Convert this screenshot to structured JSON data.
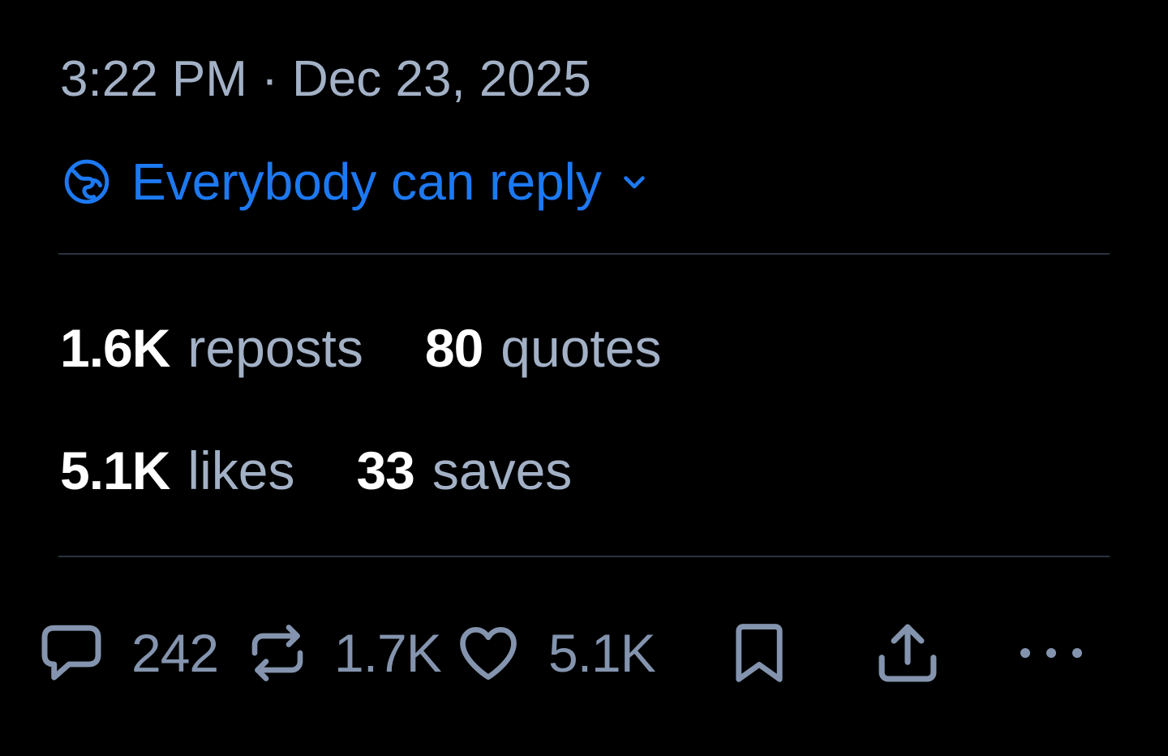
{
  "post_meta": {
    "timestamp": "3:22 PM · Dec 23, 2025",
    "reply_setting": "Everybody can reply"
  },
  "stats": {
    "reposts": {
      "count": "1.6K",
      "label": "reposts"
    },
    "quotes": {
      "count": "80",
      "label": "quotes"
    },
    "likes": {
      "count": "5.1K",
      "label": "likes"
    },
    "saves": {
      "count": "33",
      "label": "saves"
    }
  },
  "action_bar": {
    "reply_count": "242",
    "repost_count": "1.7K",
    "like_count": "5.1K"
  },
  "icons": {
    "reply_setting": "globe-icon",
    "dropdown": "chevron-down-icon",
    "reply": "speech-bubble-icon",
    "repost": "repost-arrows-icon",
    "like": "heart-icon",
    "save": "bookmark-icon",
    "share": "share-upload-icon",
    "more": "ellipsis-icon"
  },
  "colors": {
    "background": "#000000",
    "accent": "#1D79F2",
    "secondary_text": "#A3B1C6",
    "icon": "#8494AE",
    "divider": "#2A3340"
  }
}
